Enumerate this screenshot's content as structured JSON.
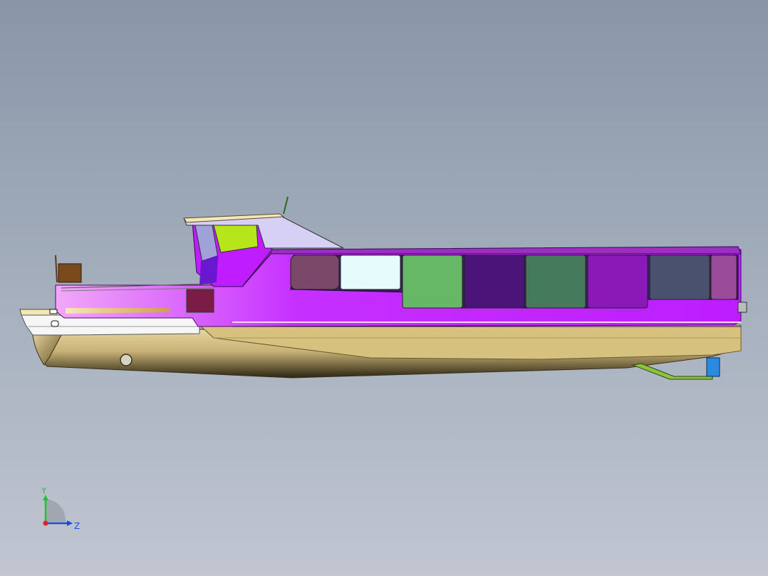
{
  "viewport": {
    "background_top": "#8996a8",
    "background_bottom": "#c1c6d1"
  },
  "model": {
    "description_colors": {
      "superstructure": "#bf1dff",
      "hull_gold": "#d8c88c",
      "roof": "#d3cdf3",
      "trim": "#f4e6b6"
    },
    "windows": [
      {
        "color": "#7a4868"
      },
      {
        "color": "#e6fbfb"
      },
      {
        "color": "#67b866"
      },
      {
        "color": "#4a1478"
      },
      {
        "color": "#457a5c"
      },
      {
        "color": "#8b19b8"
      },
      {
        "color": "#4a516e"
      },
      {
        "color": "#9a4c9a"
      }
    ],
    "wheelhouse_window_color": "#b6e61a",
    "side_window_color": "#9fa1d8",
    "hatch_color": "#7a1c46"
  },
  "triad": {
    "y_label": "Y",
    "z_label": "Z",
    "y_color": "#22c23a",
    "z_color": "#2348d8",
    "x_color": "#e0202a"
  }
}
